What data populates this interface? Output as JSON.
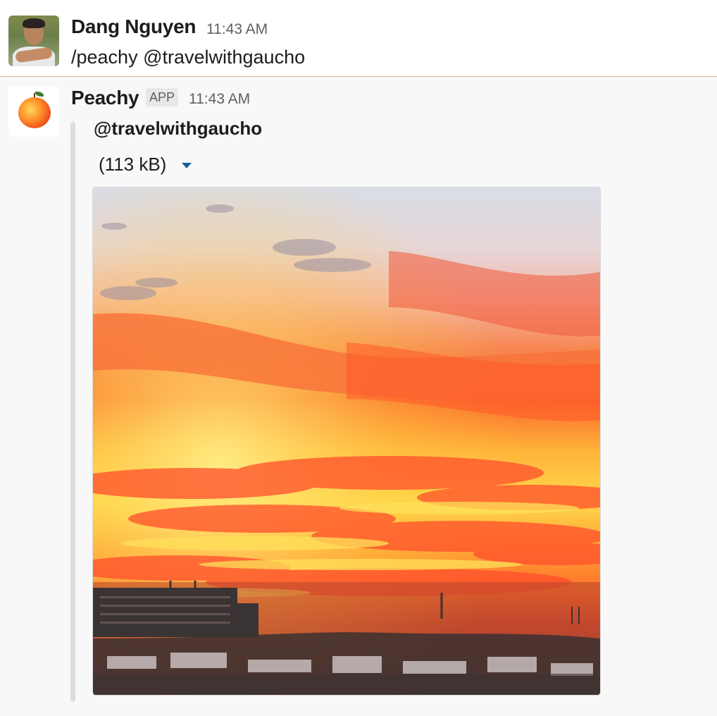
{
  "messages": [
    {
      "author": "Dang Nguyen",
      "time": "11:43 AM",
      "text": "/peachy @travelwithgaucho"
    },
    {
      "author": "Peachy",
      "badge": "APP",
      "time": "11:43 AM",
      "attachment": {
        "title": "@travelwithgaucho",
        "file_size": "(113 kB)",
        "image_subject": "sunset over city skyline"
      }
    }
  ],
  "colors": {
    "divider": "#e8a8a2",
    "link_blue": "#1264a3",
    "secondary_text": "#616061"
  },
  "icons": {
    "expand": "caret-down-icon"
  }
}
